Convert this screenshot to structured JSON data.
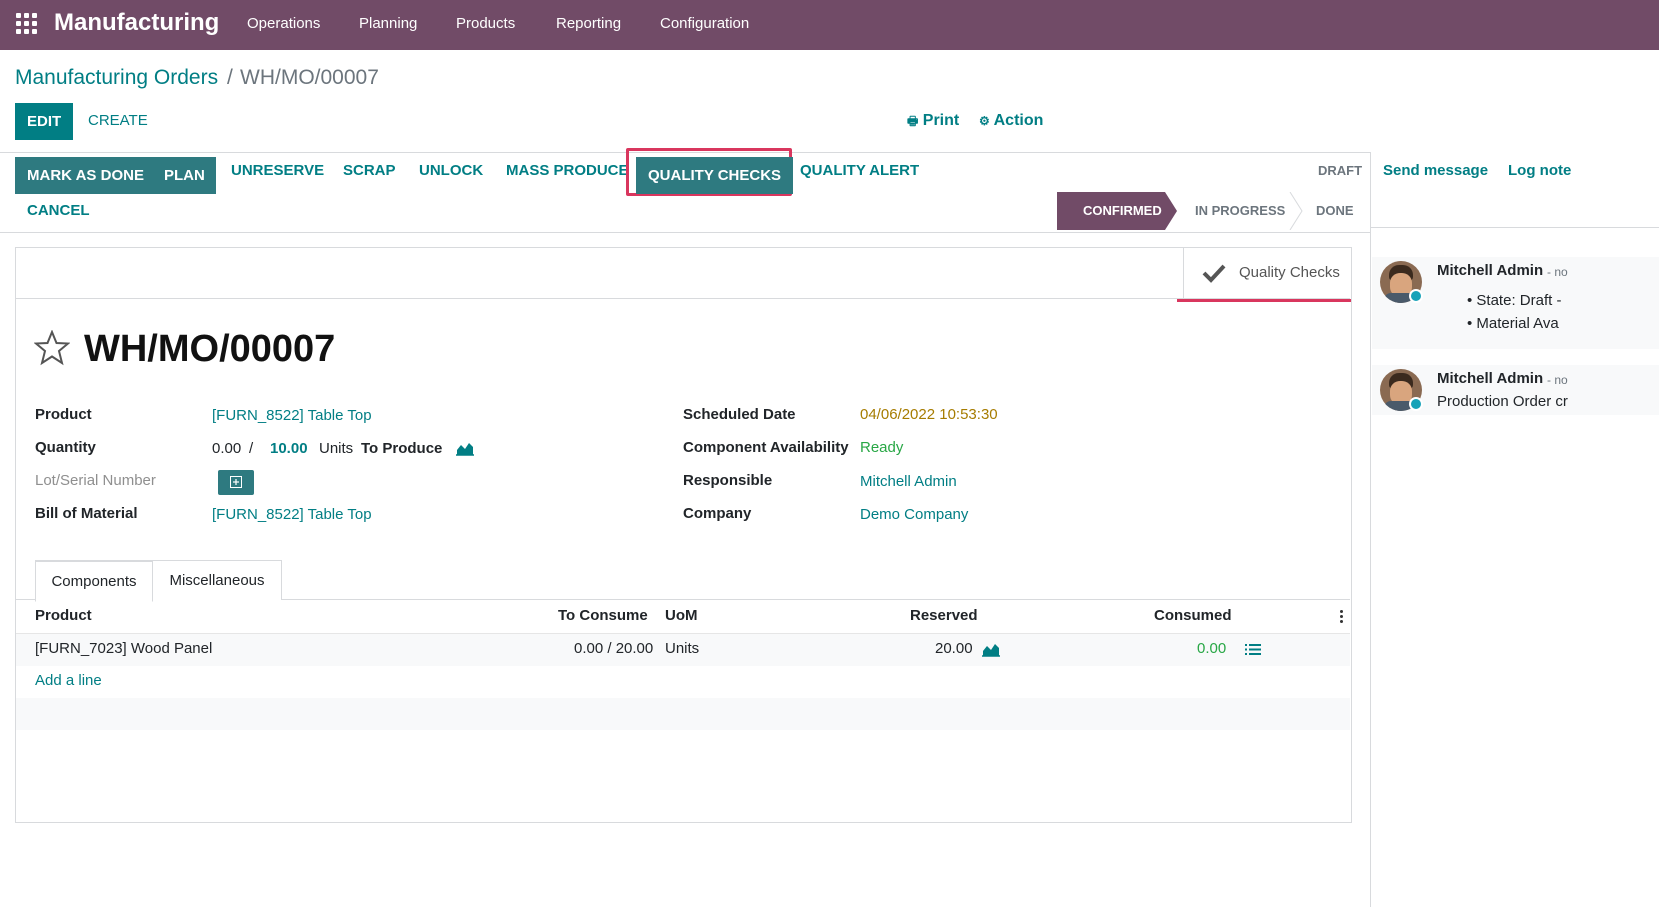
{
  "app": {
    "name": "Manufacturing"
  },
  "menu": [
    "Operations",
    "Planning",
    "Products",
    "Reporting",
    "Configuration"
  ],
  "breadcrumb": {
    "parent": "Manufacturing Orders",
    "separator": "/",
    "current": "WH/MO/00007"
  },
  "control_panel": {
    "edit": "EDIT",
    "create": "CREATE",
    "print": "Print",
    "action": "Action"
  },
  "header_buttons": {
    "mark_as_done": "MARK AS DONE",
    "plan": "PLAN",
    "unreserve": "UNRESERVE",
    "scrap": "SCRAP",
    "unlock": "UNLOCK",
    "mass_produce": "MASS PRODUCE",
    "quality_checks": "QUALITY CHECKS",
    "quality_alert": "QUALITY ALERT",
    "cancel": "CANCEL"
  },
  "status": {
    "draft": "DRAFT",
    "confirmed": "CONFIRMED",
    "in_progress": "IN PROGRESS",
    "done": "DONE",
    "active": "CONFIRMED"
  },
  "smart_button": {
    "label": "Quality Checks",
    "icon": "check-icon"
  },
  "record": {
    "name": "WH/MO/00007",
    "fields_left": {
      "product_label": "Product",
      "product_value": "[FURN_8522] Table Top",
      "quantity_label": "Quantity",
      "qty_produced": "0.00",
      "qty_sep": "/",
      "qty_total": "10.00",
      "qty_uom": "Units",
      "qty_suffix": "To Produce",
      "lot_label": "Lot/Serial Number",
      "bom_label": "Bill of Material",
      "bom_value": "[FURN_8522] Table Top"
    },
    "fields_right": {
      "scheduled_label": "Scheduled Date",
      "scheduled_value": "04/06/2022 10:53:30",
      "availability_label": "Component Availability",
      "availability_value": "Ready",
      "responsible_label": "Responsible",
      "responsible_value": "Mitchell Admin",
      "company_label": "Company",
      "company_value": "Demo Company"
    }
  },
  "tabs": {
    "components": "Components",
    "misc": "Miscellaneous"
  },
  "table": {
    "headers": {
      "product": "Product",
      "to_consume": "To Consume",
      "uom": "UoM",
      "reserved": "Reserved",
      "consumed": "Consumed"
    },
    "rows": [
      {
        "product": "[FURN_7023] Wood Panel",
        "to_consume": "0.00 / 20.00",
        "uom": "Units",
        "reserved": "20.00",
        "consumed": "0.00"
      }
    ],
    "add_line": "Add a line"
  },
  "chatter": {
    "send_message": "Send message",
    "log_note": "Log note",
    "messages": [
      {
        "author": "Mitchell Admin",
        "meta": "- no",
        "lines": [
          "State: Draft -",
          "Material Ava"
        ]
      },
      {
        "author": "Mitchell Admin",
        "meta": "- no",
        "text": "Production Order cr"
      }
    ]
  },
  "colors": {
    "brand": "#714b67",
    "primary": "#017e84",
    "highlight": "#d9365e",
    "success": "#28a745",
    "warning": "#a67c00"
  }
}
